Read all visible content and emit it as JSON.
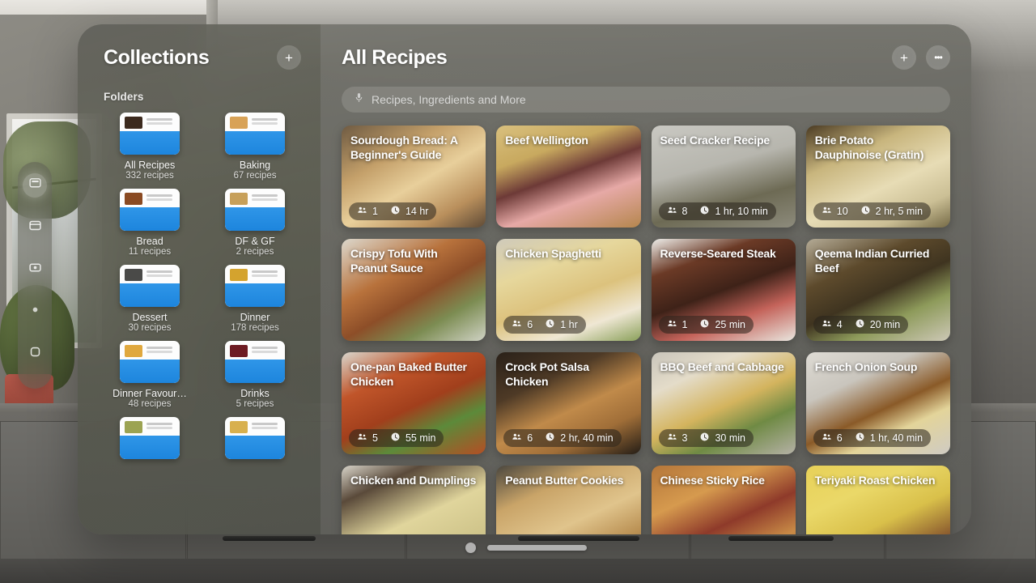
{
  "dock": {
    "items": [
      {
        "name": "home-view",
        "icon": "apps-grid-icon",
        "active": true
      },
      {
        "name": "window-view",
        "icon": "window-icon",
        "active": false
      },
      {
        "name": "media-view",
        "icon": "media-icon",
        "active": false
      },
      {
        "name": "person-view",
        "icon": "person-icon",
        "active": false
      },
      {
        "name": "environment-view",
        "icon": "square-icon",
        "active": false
      }
    ]
  },
  "sidebar": {
    "title": "Collections",
    "add_button_label": "+",
    "section_label": "Folders",
    "folders": [
      {
        "name": "All Recipes",
        "count": "332 recipes",
        "thumb": "#3c2a1e"
      },
      {
        "name": "Baking",
        "count": "67 recipes",
        "thumb": "#d8a257"
      },
      {
        "name": "Bread",
        "count": "11 recipes",
        "thumb": "#8a4a22"
      },
      {
        "name": "DF & GF",
        "count": "2 recipes",
        "thumb": "#c7a05a"
      },
      {
        "name": "Dessert",
        "count": "30 recipes",
        "thumb": "#4a4a48"
      },
      {
        "name": "Dinner",
        "count": "178 recipes",
        "thumb": "#d4a32e"
      },
      {
        "name": "Dinner Favour…",
        "count": "48 recipes",
        "thumb": "#e0a83e"
      },
      {
        "name": "Drinks",
        "count": "5 recipes",
        "thumb": "#6d1b22"
      },
      {
        "name": "",
        "count": "",
        "thumb": "#9ca352"
      },
      {
        "name": "",
        "count": "",
        "thumb": "#d8b04e"
      }
    ]
  },
  "main": {
    "title": "All Recipes",
    "add_button_label": "+",
    "more_button_label": "•••",
    "search": {
      "placeholder": "Recipes, Ingredients and More",
      "icon": "microphone-icon",
      "value": ""
    },
    "recipes": [
      {
        "title": "Sourdough Bread: A Beginner's Guide",
        "servings": "1",
        "time": "14 hr",
        "img": "linear-gradient(150deg,#6e5a42 0%,#c4a06a 32%,#e8cf9b 55%,#b98f5c 80%,#5e4a36 100%)"
      },
      {
        "title": "Beef Wellington",
        "servings": "",
        "time": "",
        "img": "linear-gradient(160deg,#d9c07e 0%,#c8a95f 28%,#6d3a37 48%,#e6a9a6 68%,#b5864d 100%)"
      },
      {
        "title": "Seed Cracker Recipe",
        "servings": "8",
        "time": "1 hr, 10 min",
        "img": "linear-gradient(165deg,#c9c8c2 0%,#b7b6ae 40%,#6d6a54 70%,#8d8b7c 100%)"
      },
      {
        "title": "Brie Potato Dauphinoise (Gratin)",
        "servings": "10",
        "time": "2 hr, 5 min",
        "img": "linear-gradient(155deg,#4a3a22 0%,#c8b57d 30%,#e7dcb5 58%,#cbbf95 80%,#756a46 100%)"
      },
      {
        "title": "Crispy Tofu With Peanut Sauce",
        "servings": "",
        "time": "",
        "img": "linear-gradient(150deg,#dcd8cd 0%,#b8723c 35%,#8d4e28 55%,#7c8c52 75%,#cfd2c4 100%)"
      },
      {
        "title": "Chicken Spaghetti",
        "servings": "6",
        "time": "1 hr",
        "img": "linear-gradient(160deg,#cfcabb 0%,#e6d79c 30%,#dcc27d 55%,#efe7d4 78%,#8aa05a 100%)"
      },
      {
        "title": "Reverse-Seared Steak",
        "servings": "1",
        "time": "25 min",
        "img": "linear-gradient(160deg,#efeeea 0%,#6b3a26 25%,#3e2218 50%,#c4635a 72%,#e9e6df 100%)"
      },
      {
        "title": "Qeema Indian Curried Beef",
        "servings": "4",
        "time": "20 min",
        "img": "linear-gradient(155deg,#b4ab96 0%,#5d4a2c 30%,#3f3420 52%,#8d9a5a 72%,#cdc8b6 100%)"
      },
      {
        "title": "One-pan Baked Butter Chicken",
        "servings": "5",
        "time": "55 min",
        "img": "linear-gradient(155deg,#d9d6cd 0%,#c0552a 28%,#a13f1c 52%,#5c8a3a 72%,#b44e24 100%)"
      },
      {
        "title": "Crock Pot Salsa Chicken",
        "servings": "6",
        "time": "2 hr, 40 min",
        "img": "linear-gradient(155deg,#2a2119 0%,#4e3a26 30%,#c08a4a 55%,#a06e38 75%,#241d16 100%)"
      },
      {
        "title": "BBQ Beef and Cabbage",
        "servings": "3",
        "time": "30 min",
        "img": "linear-gradient(155deg,#c9c5bb 0%,#e4dcc9 25%,#d4b45e 52%,#6f8a44 72%,#b5b1a6 100%)"
      },
      {
        "title": "French Onion Soup",
        "servings": "6",
        "time": "1 hr, 40 min",
        "img": "linear-gradient(155deg,#dedbd4 0%,#c9c5bd 30%,#8a5a28 55%,#e3d49a 72%,#cfcbc3 100%)"
      },
      {
        "title": "Chicken and Dumplings",
        "servings": "",
        "time": "",
        "img": "linear-gradient(155deg,#d8d4c9 0%,#5a4a3a 22%,#e0d59c 52%,#cfc48a 78%,#b7b2a4 100%)"
      },
      {
        "title": "Peanut Butter Cookies",
        "servings": "",
        "time": "",
        "img": "linear-gradient(155deg,#4a463e 0%,#c9a468 28%,#e0c48c 55%,#b98f52 78%,#55504a 100%)"
      },
      {
        "title": "Chinese Sticky Rice",
        "servings": "",
        "time": "",
        "img": "linear-gradient(155deg,#b4763a 0%,#d69a4e 30%,#8e3a2a 55%,#c88a46 78%,#a0602e 100%)"
      },
      {
        "title": "Teriyaki Roast Chicken",
        "servings": "",
        "time": "",
        "img": "linear-gradient(155deg,#e8d158 0%,#ead868 30%,#d9c04a 55%,#8a5a2e 80%,#cdb046 100%)"
      }
    ]
  },
  "window_controls": {
    "close_label": "close",
    "resize_label": "resize-handle"
  },
  "colors": {
    "folder_blue": "#2f96e8",
    "panel": "#6c6c65",
    "text": "#ffffff"
  }
}
